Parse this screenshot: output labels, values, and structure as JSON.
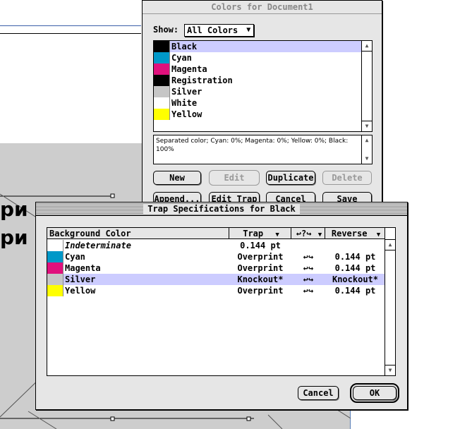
{
  "document": {
    "partial_text_1": "ри",
    "partial_text_2": "ри"
  },
  "colors_window": {
    "title": "Colors for Document1",
    "show_label": "Show:",
    "show_value": "All Colors",
    "colors": [
      {
        "name": "Black",
        "swatch": "#000000",
        "selected": true
      },
      {
        "name": "Cyan",
        "swatch": "#0098c8"
      },
      {
        "name": "Magenta",
        "swatch": "#e0107c"
      },
      {
        "name": "Registration",
        "swatch": "#000000"
      },
      {
        "name": "Silver",
        "swatch": "#c6c6c6"
      },
      {
        "name": "White",
        "swatch": "#ffffff"
      },
      {
        "name": "Yellow",
        "swatch": "#ffff00"
      }
    ],
    "description": "Separated color; Cyan: 0%; Magenta: 0%; Yellow: 0%; Black: 100%",
    "buttons": {
      "new": "New",
      "edit": "Edit",
      "duplicate": "Duplicate",
      "delete": "Delete",
      "append": "Append...",
      "edit_trap": "Edit Trap",
      "cancel": "Cancel",
      "save": "Save"
    }
  },
  "trap_window": {
    "title": "Trap Specifications for Black",
    "headers": {
      "background": "Background Color",
      "trap": "Trap",
      "arrows": "↩?↪",
      "reverse": "Reverse"
    },
    "rows": [
      {
        "name": "Indeterminate",
        "swatch": "#ffffff",
        "trap": "0.144 pt",
        "arrows": "",
        "reverse": "",
        "italic": true
      },
      {
        "name": "Cyan",
        "swatch": "#0098c8",
        "trap": "Overprint",
        "arrows": "↩↪",
        "reverse": "0.144 pt"
      },
      {
        "name": "Magenta",
        "swatch": "#e0107c",
        "trap": "Overprint",
        "arrows": "↩↪",
        "reverse": "0.144 pt"
      },
      {
        "name": "Silver",
        "swatch": "#c6c6c6",
        "trap": "Knockout*",
        "arrows": "↩↪",
        "reverse": "Knockout*",
        "selected": true
      },
      {
        "name": "Yellow",
        "swatch": "#ffff00",
        "trap": "Overprint",
        "arrows": "↩↪",
        "reverse": "0.144 pt"
      }
    ],
    "buttons": {
      "cancel": "Cancel",
      "ok": "OK"
    }
  },
  "colors": {
    "selection": "#ccccff",
    "window_bg": "#e6e6e6"
  }
}
